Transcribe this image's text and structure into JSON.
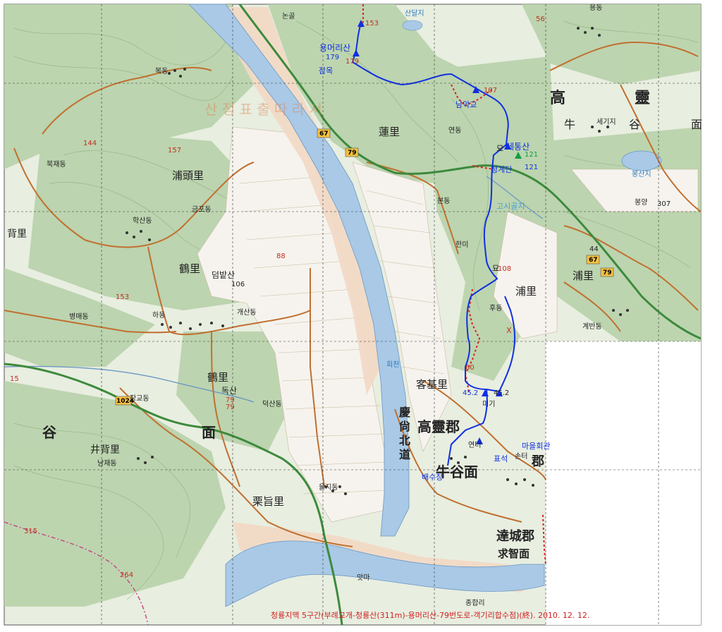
{
  "map": {
    "hanja_labels": {
      "counties": [
        "高靈郡",
        "達城郡"
      ],
      "districts": [
        "牛谷面",
        "求智面",
        "牛谷面"
      ],
      "villages": [
        "蓮里",
        "浦頭里",
        "鶴里",
        "鶴里",
        "客基里",
        "井背里",
        "栗旨里",
        "浦里",
        "浦里",
        "背里"
      ],
      "road": "慶尙北道",
      "side_chars": [
        "高",
        "靈",
        "牛",
        "谷",
        "面",
        "谷",
        "面",
        "郡"
      ]
    },
    "places": [
      "논골",
      "복동",
      "북재동",
      "금포동",
      "학산동",
      "개산동",
      "하동",
      "병매동",
      "장교동",
      "덕산동",
      "남재동",
      "율지동",
      "연동",
      "한미",
      "후동",
      "본동",
      "미기",
      "연터",
      "손터",
      "봉양",
      "세기지",
      "계반동",
      "앗마",
      "종합리",
      "용동"
    ],
    "peaks": [
      {
        "name": "용머리산",
        "height": "179"
      },
      {
        "name": "덤밭산",
        "height": "106"
      },
      {
        "name": "독산",
        "height": "79"
      },
      {
        "name": "세통산",
        "height": "121"
      }
    ],
    "elevations": [
      "153",
      "179",
      "107",
      "121",
      "108",
      "45.2",
      "45.2",
      "60",
      "88",
      "157",
      "144",
      "153",
      "15",
      "79",
      "264",
      "315",
      "44",
      "307",
      "56"
    ],
    "route_labels": [
      "잠목",
      "남악교",
      "청계단",
      "고시골지",
      "마을회관",
      "표석",
      "배수장",
      "묘",
      "묘",
      "X"
    ],
    "water_labels": [
      "산달지",
      "봉산지",
      "회천"
    ],
    "road_numbers": [
      "67",
      "79",
      "67",
      "79",
      "1024"
    ],
    "faded_text": "산 정 표 출 따 라 서",
    "caption": "청룡지맥 5구간(부례교개-청룡산(311m)-용머리산-79번도로-객기리합수점)(終). 2010. 12. 12.",
    "colors": {
      "terrain": "#bcd4b0",
      "river": "#a8c8e8",
      "road": "#c07030",
      "route": "#1030e0",
      "dotted": "#e02020",
      "text": "#222222"
    }
  }
}
